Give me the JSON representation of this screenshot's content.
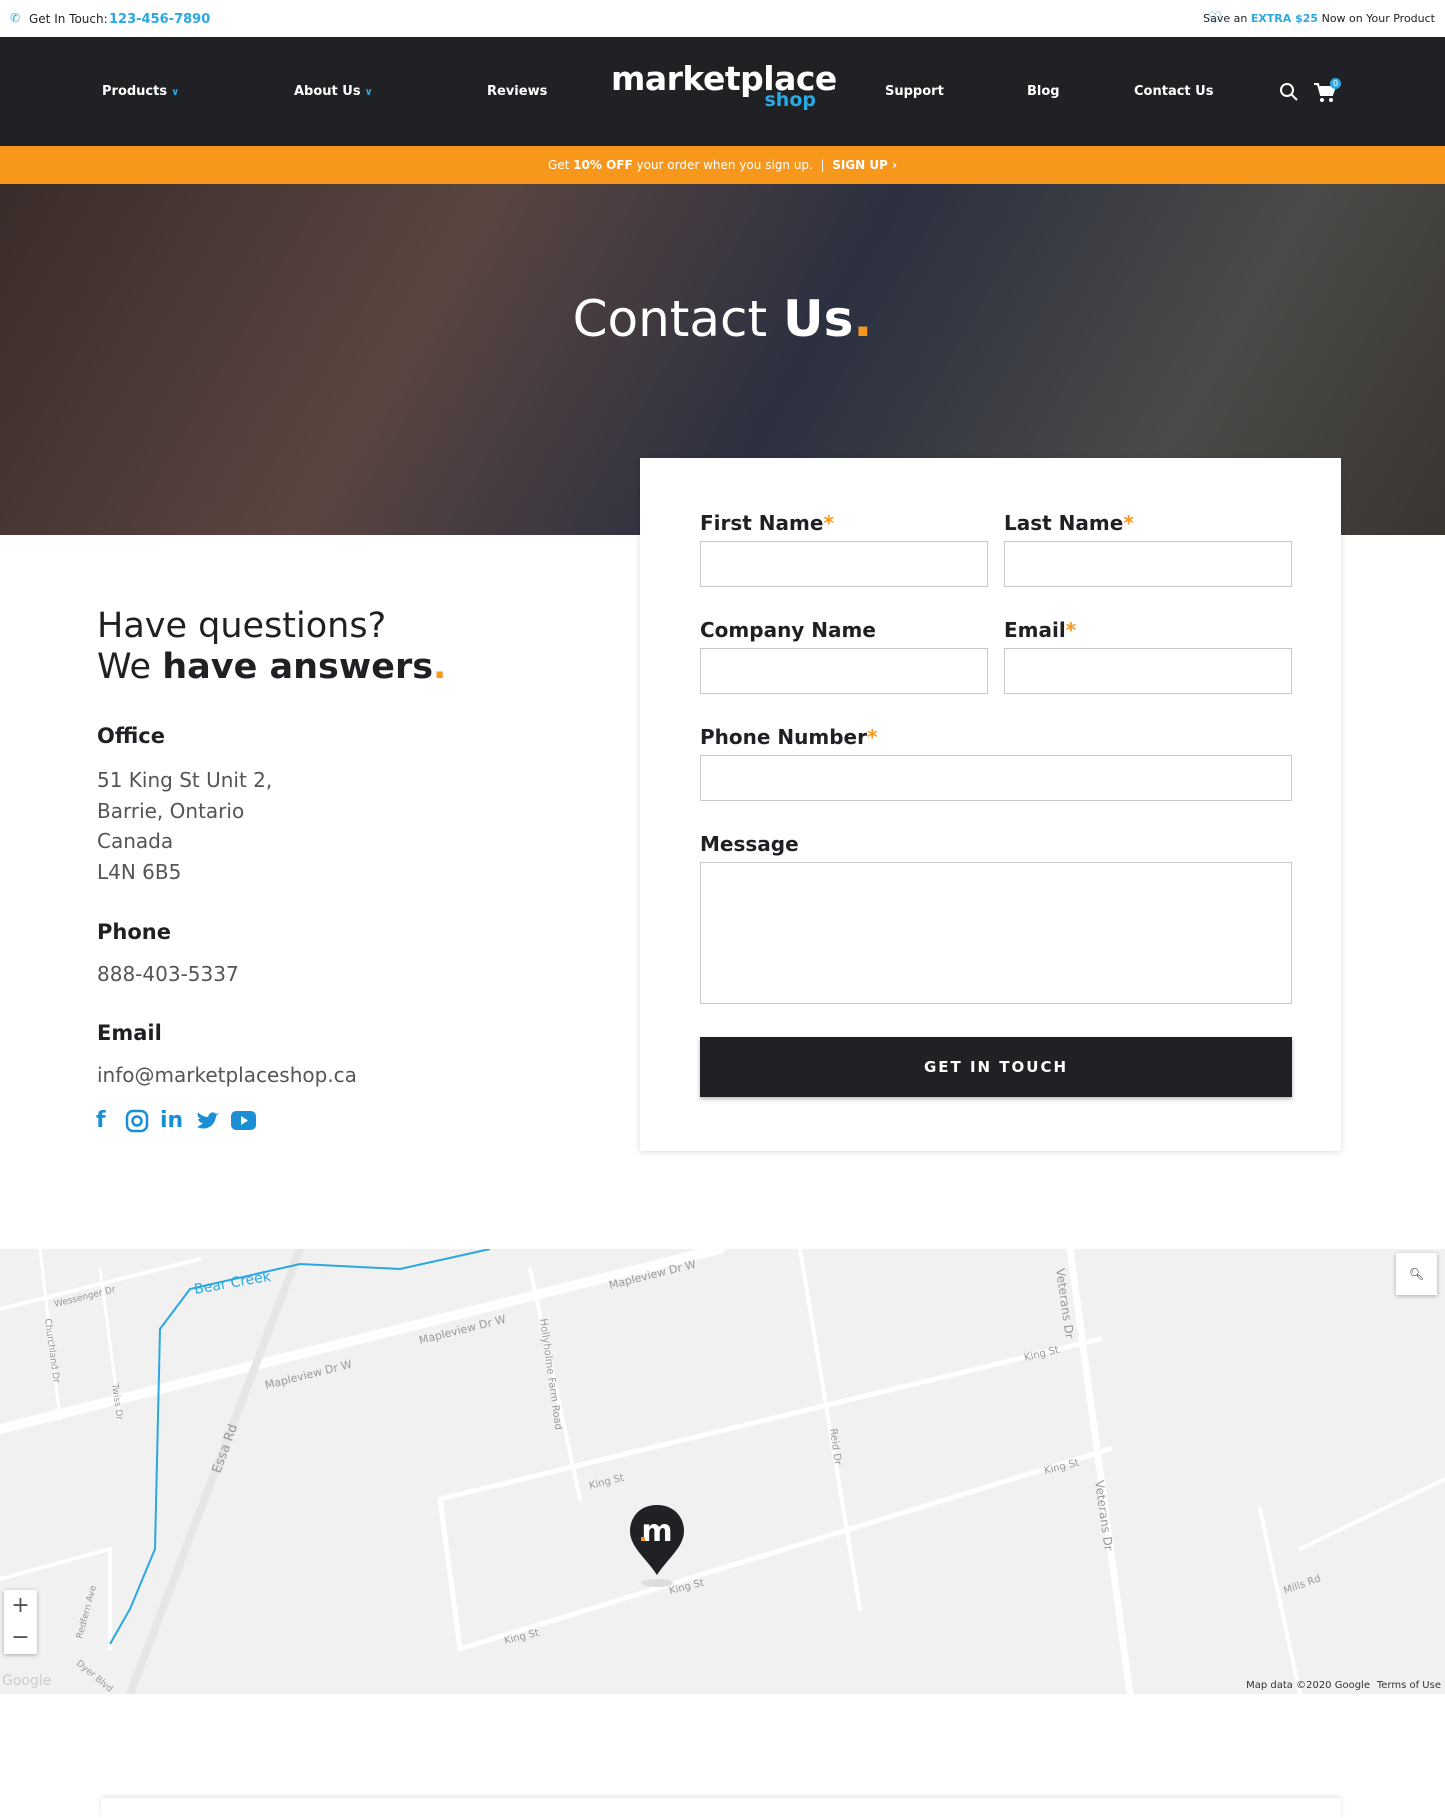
{
  "topbar": {
    "contact_label": "Get In Touch:",
    "phone": "123-456-7890",
    "promo_prefix": "Save an",
    "promo_highlight": "EXTRA $25",
    "promo_suffix": "Now on Your Product"
  },
  "nav": {
    "items": [
      {
        "label": "Products",
        "dropdown": true
      },
      {
        "label": "About Us",
        "dropdown": true
      },
      {
        "label": "Reviews"
      },
      {
        "label": "Support"
      },
      {
        "label": "Blog"
      },
      {
        "label": "Contact Us"
      }
    ],
    "logo_main": "marketplace",
    "logo_sub": "shop",
    "cart_count": "0"
  },
  "promo": {
    "prefix": "Get",
    "bold": "10% OFF",
    "suffix": "your order when you sign up.",
    "separator": "|",
    "cta": "SIGN UP"
  },
  "hero": {
    "title_light": "Contact",
    "title_bold": "Us",
    "title_dot": "."
  },
  "info": {
    "heading_line1": "Have questions?",
    "heading_line2_light": "We",
    "heading_line2_bold": "have answers",
    "dot": ".",
    "office_title": "Office",
    "address": [
      "51 King St Unit 2,",
      "Barrie, Ontario",
      "Canada",
      "L4N 6B5"
    ],
    "phone_title": "Phone",
    "phone": "888-403-5337",
    "email_title": "Email",
    "email": "info@marketplaceshop.ca",
    "social": [
      "facebook",
      "instagram",
      "linkedin",
      "twitter",
      "youtube"
    ]
  },
  "form": {
    "first_name": "First Name",
    "last_name": "Last Name",
    "company": "Company Name",
    "email": "Email",
    "phone": "Phone Number",
    "message": "Message",
    "required_mark": "*",
    "submit": "GET IN TOUCH"
  },
  "map": {
    "streets": [
      "Mapleview Dr W",
      "Mapleview Dr W",
      "Mapleview Dr W",
      "Essa Rd",
      "King St",
      "King St",
      "King St",
      "King St",
      "King St",
      "Veterans Dr",
      "Veterans Dr",
      "Reid Dr",
      "Hollyholme Farm Road",
      "Mills Rd",
      "Wessenger Dr",
      "Churchland Dr",
      "Twiss Dr",
      "Bear Creek",
      "Redfern Ave",
      "Dyer Blvd"
    ],
    "attribution": "Map data ©2020 Google",
    "terms": "Terms of Use",
    "google": "Google",
    "zoom_in": "+",
    "zoom_out": "−"
  },
  "colors": {
    "accent": "#f7981d",
    "brand_blue": "#2aa8e0",
    "dark": "#202125"
  }
}
